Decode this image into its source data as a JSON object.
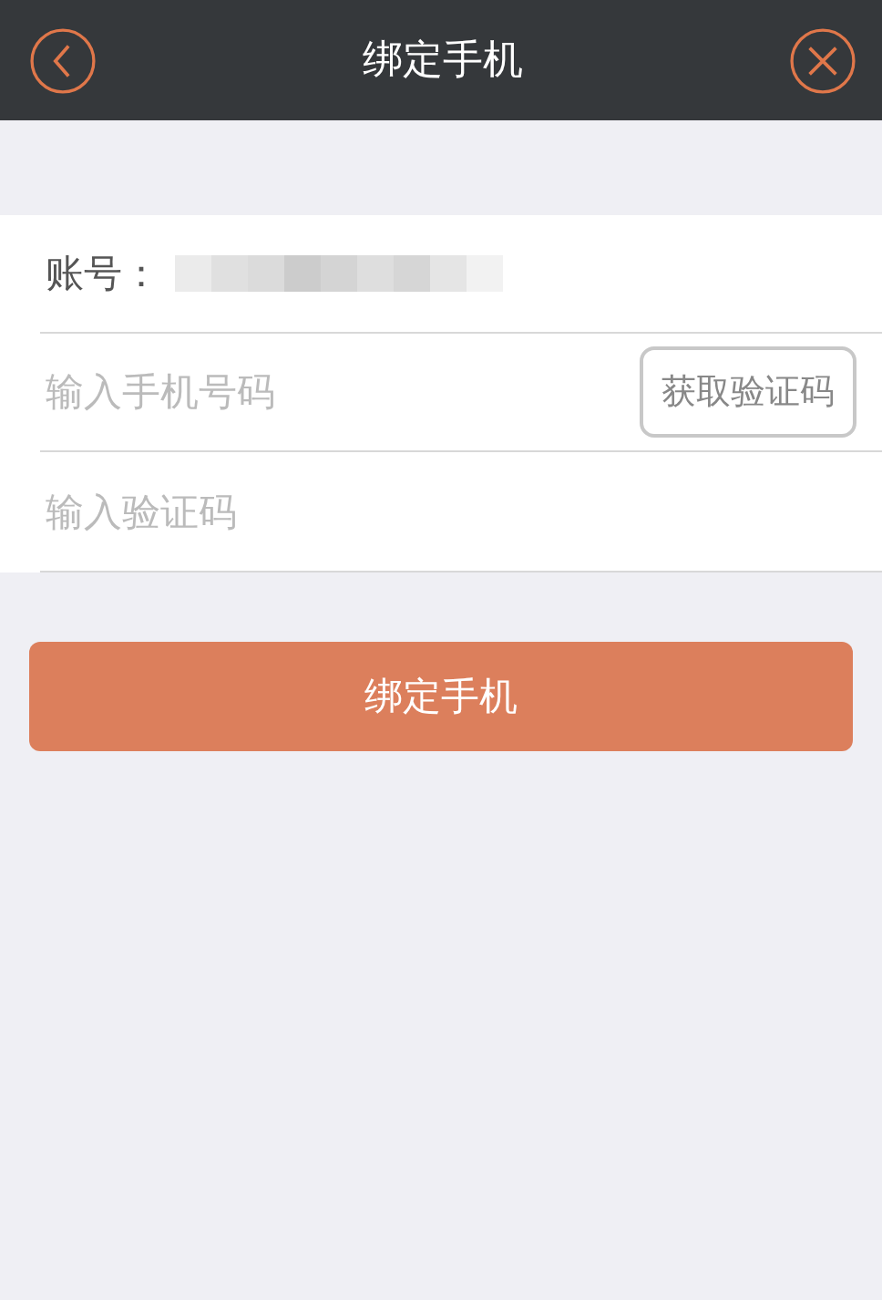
{
  "header": {
    "title": "绑定手机"
  },
  "account": {
    "label": "账号："
  },
  "phone_field": {
    "placeholder": "输入手机号码"
  },
  "code_button": {
    "label": "获取验证码"
  },
  "code_field": {
    "placeholder": "输入验证码"
  },
  "submit_button": {
    "label": "绑定手机"
  }
}
